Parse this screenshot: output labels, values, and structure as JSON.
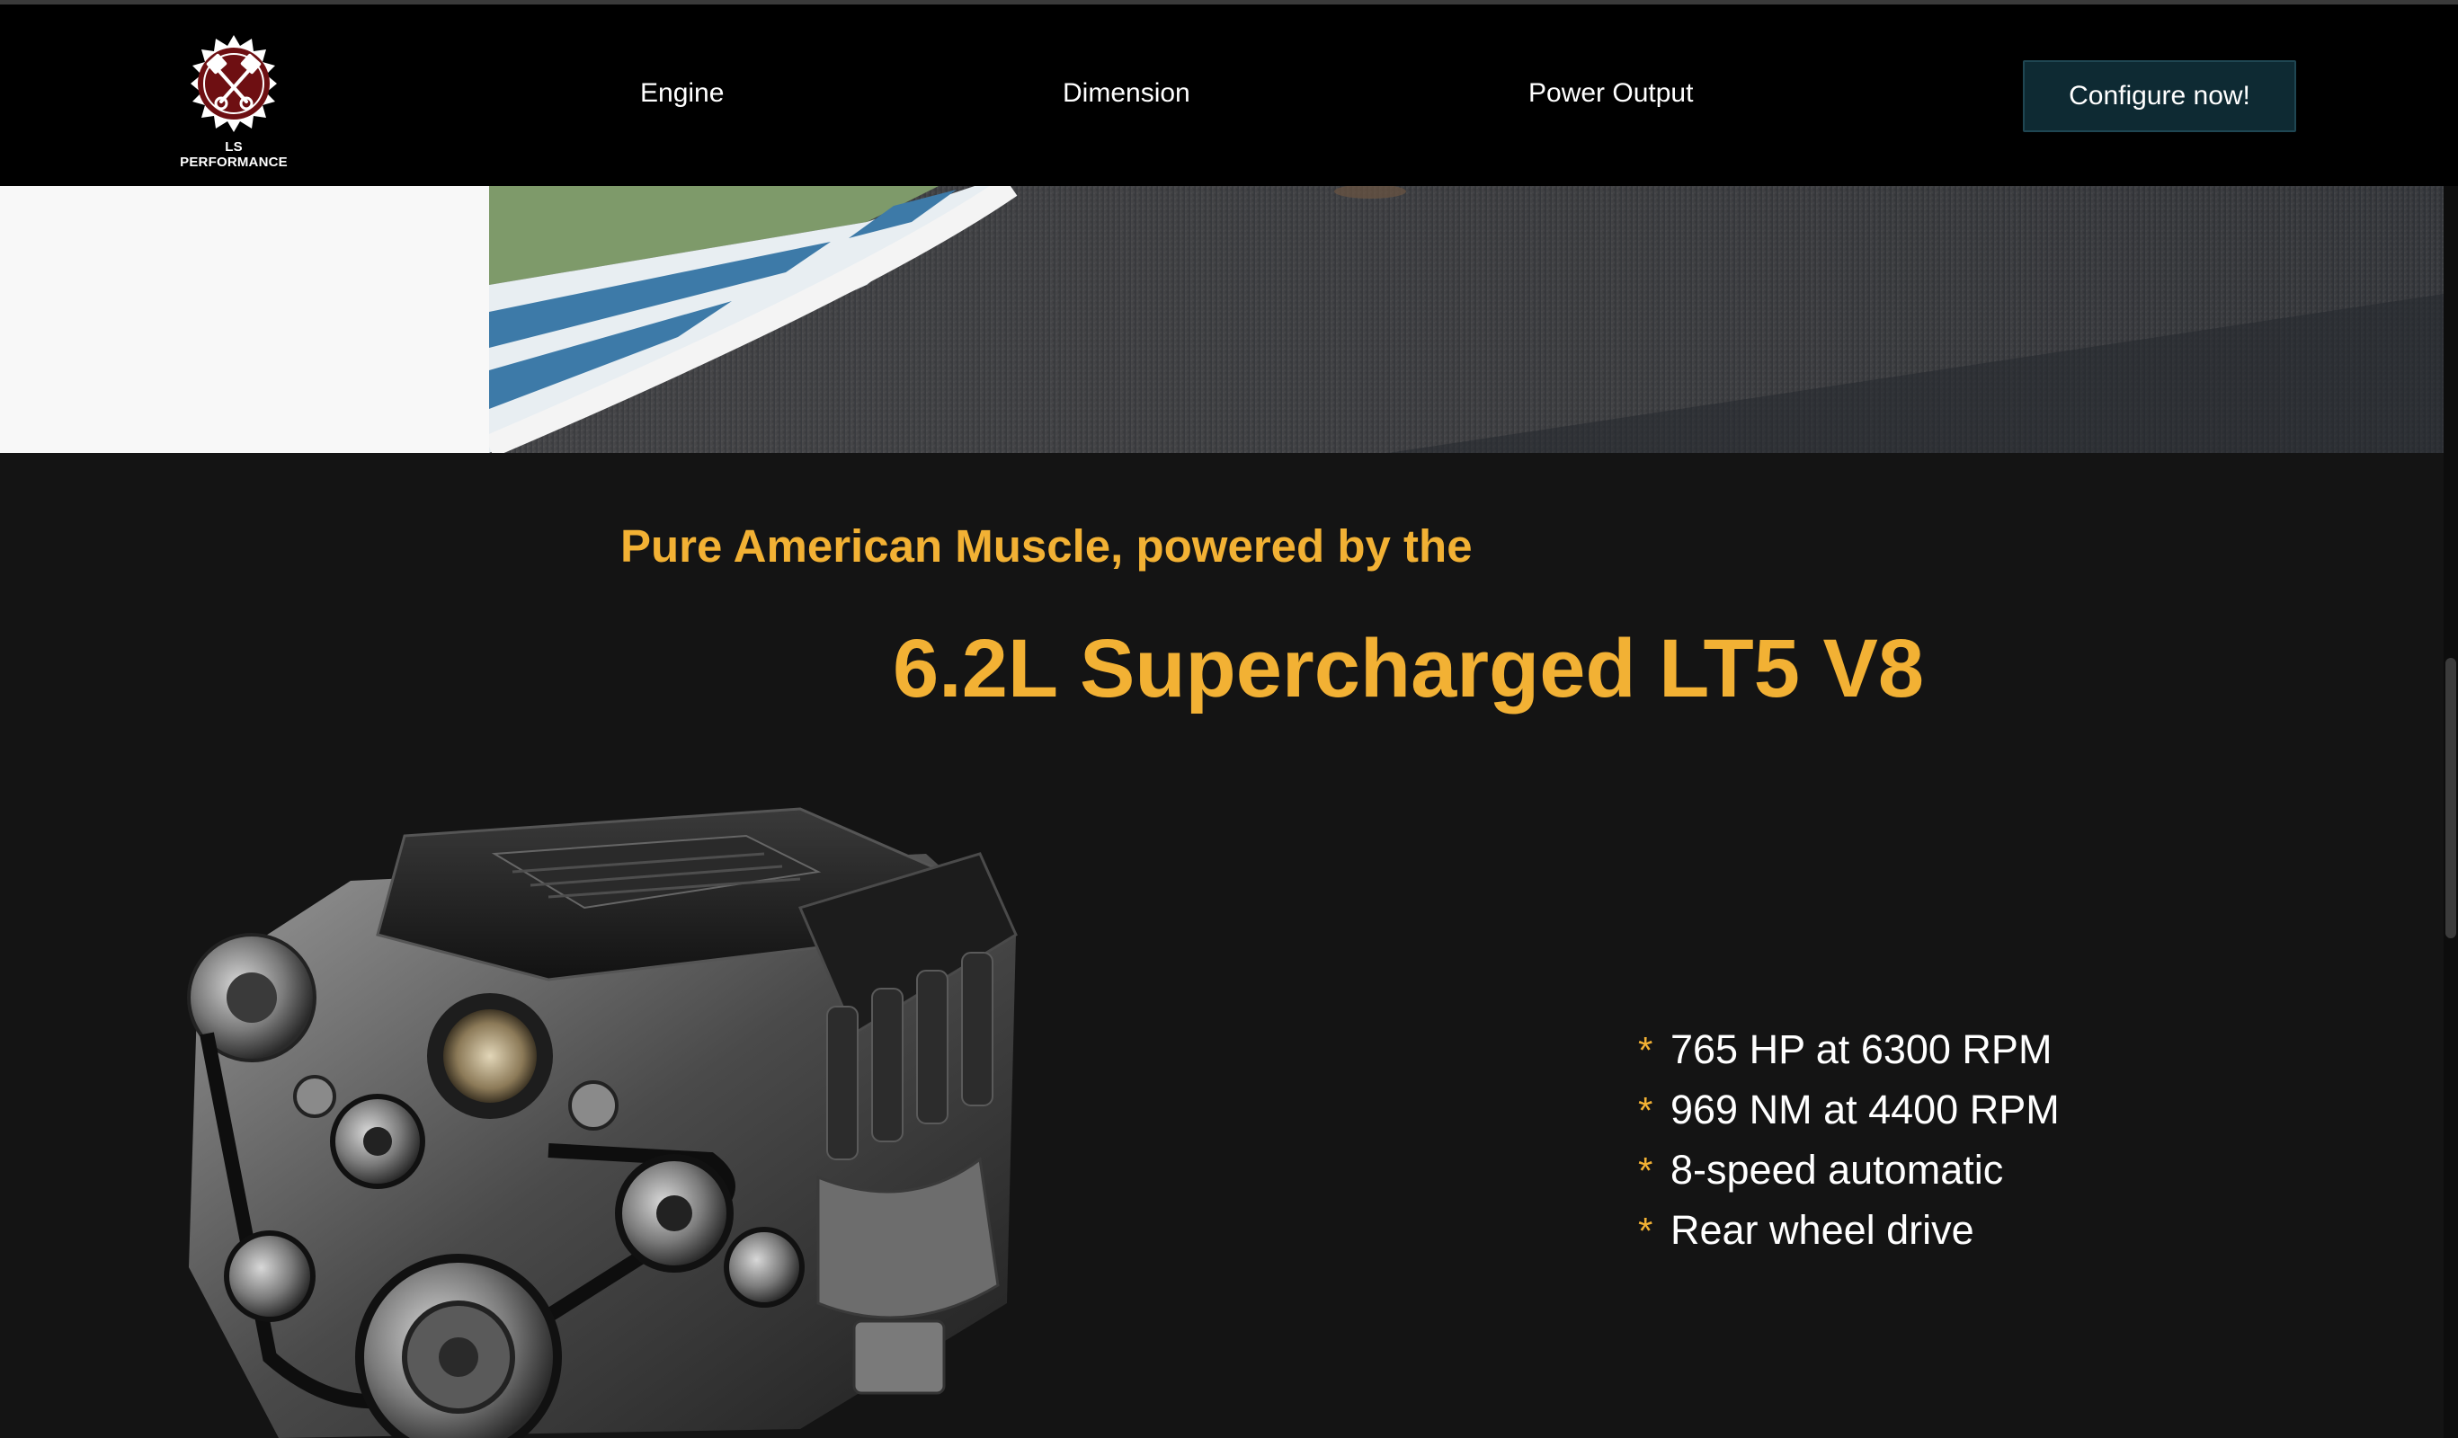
{
  "brand": {
    "logo_text": "LS PERFORMANCE",
    "logo_color": "#6e0f12"
  },
  "nav": {
    "links": [
      "Engine",
      "Dimension",
      "Power Output"
    ],
    "cta_label": "Configure now!"
  },
  "engine_section": {
    "subheading": "Pure American Muscle, powered by the",
    "heading": "6.2L Supercharged LT5 V8",
    "bullet_symbol": "*",
    "specs": [
      "765 HP at 6300 RPM",
      "969 NM at 4400 RPM",
      "8-speed automatic",
      "Rear wheel drive"
    ]
  },
  "colors": {
    "accent": "#f2b134",
    "background": "#141414",
    "navbar": "#000000",
    "cta_background": "#0e2a33"
  }
}
